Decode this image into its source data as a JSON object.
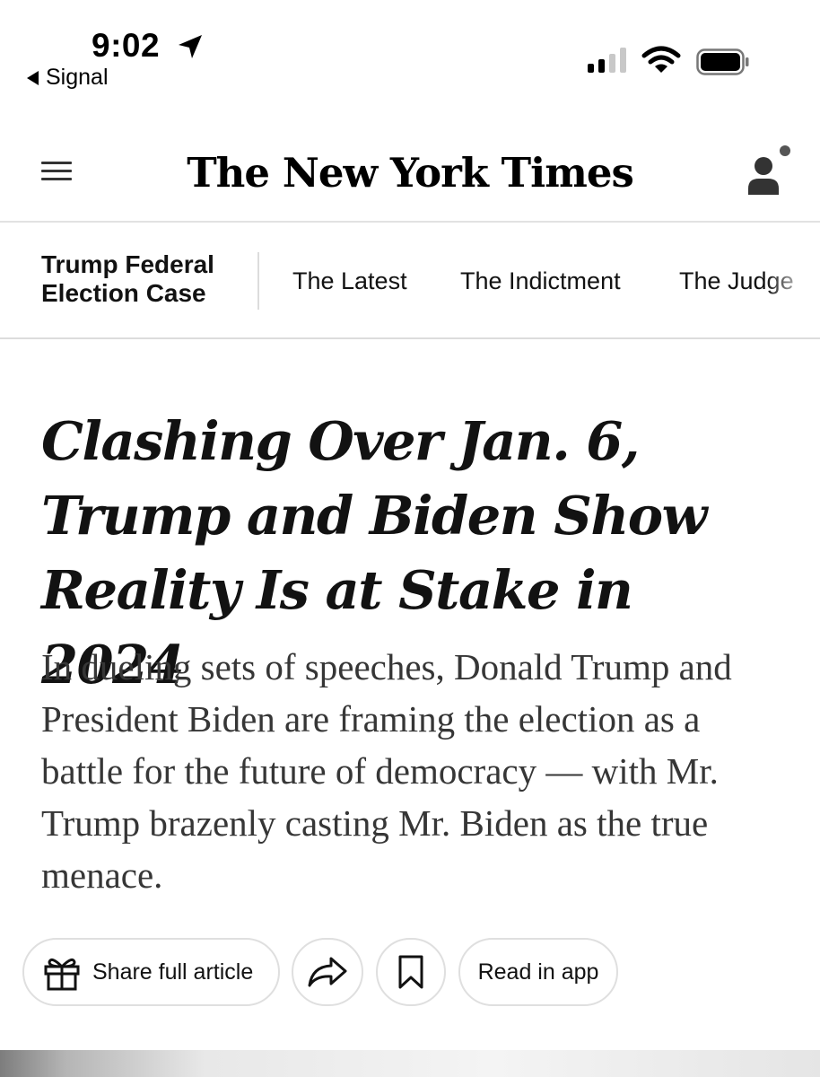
{
  "status_bar": {
    "time": "9:02",
    "back_app": "Signal",
    "icons": [
      "location-arrow-icon",
      "cellular-signal-icon",
      "wifi-icon",
      "battery-icon"
    ]
  },
  "masthead": {
    "logo": "The New York Times",
    "icons": [
      "hamburger-menu-icon",
      "account-icon"
    ]
  },
  "section_nav": {
    "section_title": "Trump Federal Election Case",
    "tabs": [
      {
        "label": "The Latest"
      },
      {
        "label": "The Indictment"
      },
      {
        "label": "The Judge"
      }
    ]
  },
  "article": {
    "headline": "Clashing Over Jan. 6, Trump and Biden Show Reality Is at Stake in 2024",
    "summary": "In dueling sets of speeches, Donald Trump and President Biden are framing the election as a battle for the future of democracy — with Mr. Trump brazenly casting Mr. Biden as the true menace."
  },
  "actions": {
    "share_full_article": "Share full article",
    "read_in_app": "Read in app",
    "icons": [
      "gift-icon",
      "share-arrow-icon",
      "bookmark-icon"
    ]
  },
  "colors": {
    "text": "#121212",
    "summary_text": "#363636",
    "divider": "#dcdcdc",
    "pill_border": "#dfdfdf"
  }
}
